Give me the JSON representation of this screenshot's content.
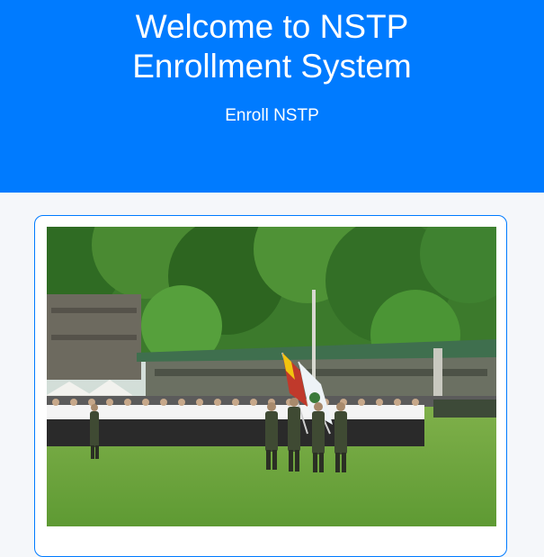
{
  "hero": {
    "title_line1": "Welcome to NSTP",
    "title_line2": "Enrollment System",
    "link_label": "Enroll NSTP"
  },
  "colors": {
    "primary": "#007bff",
    "page_background": "#f5f7fa",
    "card_background": "#ffffff"
  },
  "card": {
    "image_icon": "nstp-formation-photo"
  }
}
